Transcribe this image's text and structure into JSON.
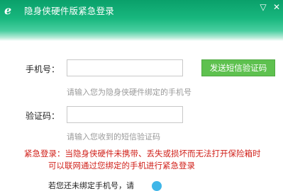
{
  "window": {
    "title": "隐身侠硬件版紧急登录",
    "logo_glyph": "ℯ",
    "min_icon": "▽",
    "close_icon": "✕"
  },
  "form": {
    "phone_label": "手机号：",
    "phone_value": "",
    "phone_hint": "请输入您为隐身侠硬件绑定的手机号",
    "send_button": "发送短信验证码",
    "code_label": "验证码：",
    "code_value": "",
    "code_hint": "请输入您收到的短信验证码"
  },
  "notice": {
    "line1": "紧急登录：当隐身侠硬件未携带、丢失或损坏而无法打开保险箱时",
    "line2": "可以联网通过您绑定的手机进行紧急登录"
  },
  "bottom": {
    "text": "若您还未绑定手机号，请"
  },
  "colors": {
    "title_green": "#0aa06a",
    "button_green": "#5ec14f",
    "warning_red": "#d0201a",
    "hint_gray": "#9a9a9a"
  }
}
